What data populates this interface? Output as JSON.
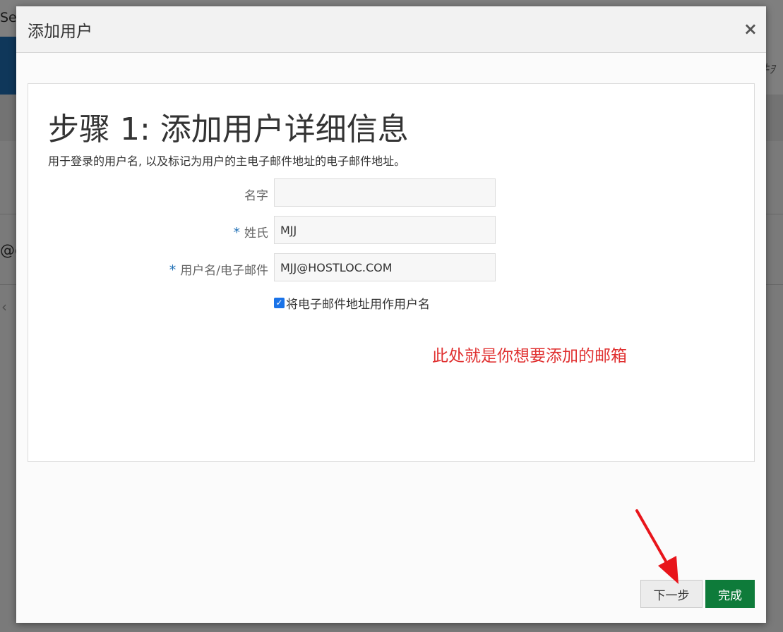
{
  "background": {
    "topbar_text": "Se",
    "bluebar_text": "件ｦ",
    "row_text": "@c",
    "chevron": "‹"
  },
  "modal": {
    "title": "添加用户",
    "close_label": "×"
  },
  "step": {
    "title": "步骤 1: 添加用户详细信息",
    "description": "用于登录的用户名, 以及标记为用户的主电子邮件地址的电子邮件地址。"
  },
  "form": {
    "first_name": {
      "label": "名字",
      "value": "",
      "required": false
    },
    "last_name": {
      "label": "姓氏",
      "value": "MJJ",
      "required": true
    },
    "username": {
      "label": "用户名/电子邮件",
      "value": "MJJ@HOSTLOC.COM",
      "required": true
    },
    "required_marker": "*",
    "use_email_checkbox": {
      "label": "将电子邮件地址用作用户名",
      "checked": true
    }
  },
  "annotation": {
    "text": "此处就是你想要添加的邮箱",
    "color": "#e03030"
  },
  "footer": {
    "next_label": "下一步",
    "finish_label": "完成"
  },
  "colors": {
    "accent": "#1f6fb5",
    "finish": "#0e7b3a",
    "checkbox": "#1a73e8",
    "arrow": "#e8151b"
  }
}
